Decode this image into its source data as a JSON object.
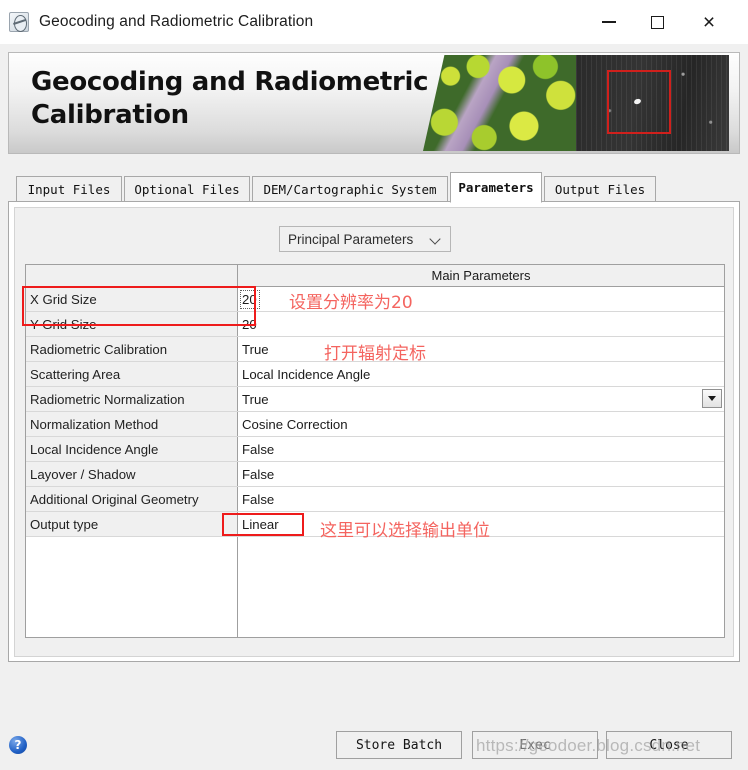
{
  "window": {
    "title": "Geocoding and Radiometric Calibration",
    "icon": "app-sphere-icon",
    "minimize_label": "",
    "maximize_label": "",
    "close_label": "×"
  },
  "banner": {
    "title": "Geocoding and Radiometric Calibration"
  },
  "tabs": [
    {
      "label": "Input Files",
      "active": false
    },
    {
      "label": "Optional Files",
      "active": false
    },
    {
      "label": "DEM/Cartographic System",
      "active": false
    },
    {
      "label": "Parameters",
      "active": true
    },
    {
      "label": "Output Files",
      "active": false
    }
  ],
  "parameter_set": {
    "selected": "Principal Parameters",
    "caret": "chevron-down-icon"
  },
  "table": {
    "headers": [
      "",
      "Main Parameters"
    ],
    "rows": [
      {
        "name": "X Grid Size",
        "value": "20",
        "editing": true,
        "combo": false
      },
      {
        "name": "Y Grid Size",
        "value": "20",
        "editing": false,
        "combo": false
      },
      {
        "name": "Radiometric Calibration",
        "value": "True",
        "editing": false,
        "combo": false
      },
      {
        "name": "Scattering Area",
        "value": "Local Incidence Angle",
        "editing": false,
        "combo": false
      },
      {
        "name": "Radiometric Normalization",
        "value": "True",
        "editing": false,
        "combo": true
      },
      {
        "name": "Normalization Method",
        "value": "Cosine Correction",
        "editing": false,
        "combo": false
      },
      {
        "name": "Local Incidence Angle",
        "value": "False",
        "editing": false,
        "combo": false
      },
      {
        "name": "Layover / Shadow",
        "value": "False",
        "editing": false,
        "combo": false
      },
      {
        "name": "Additional Original Geometry",
        "value": "False",
        "editing": false,
        "combo": false
      },
      {
        "name": "Output type",
        "value": "Linear",
        "editing": false,
        "combo": false
      }
    ]
  },
  "annotations": {
    "color": "#f4645f",
    "box_color": "#ee1b1b",
    "note_grid": "设置分辨率为20",
    "note_calibration": "打开辐射定标",
    "note_output": "这里可以选择输出单位"
  },
  "footer": {
    "help_icon": "?",
    "store_batch": "Store Batch",
    "exec": "Exec",
    "close": "Close",
    "watermark": "https://geodoer.blog.csdn.net"
  }
}
